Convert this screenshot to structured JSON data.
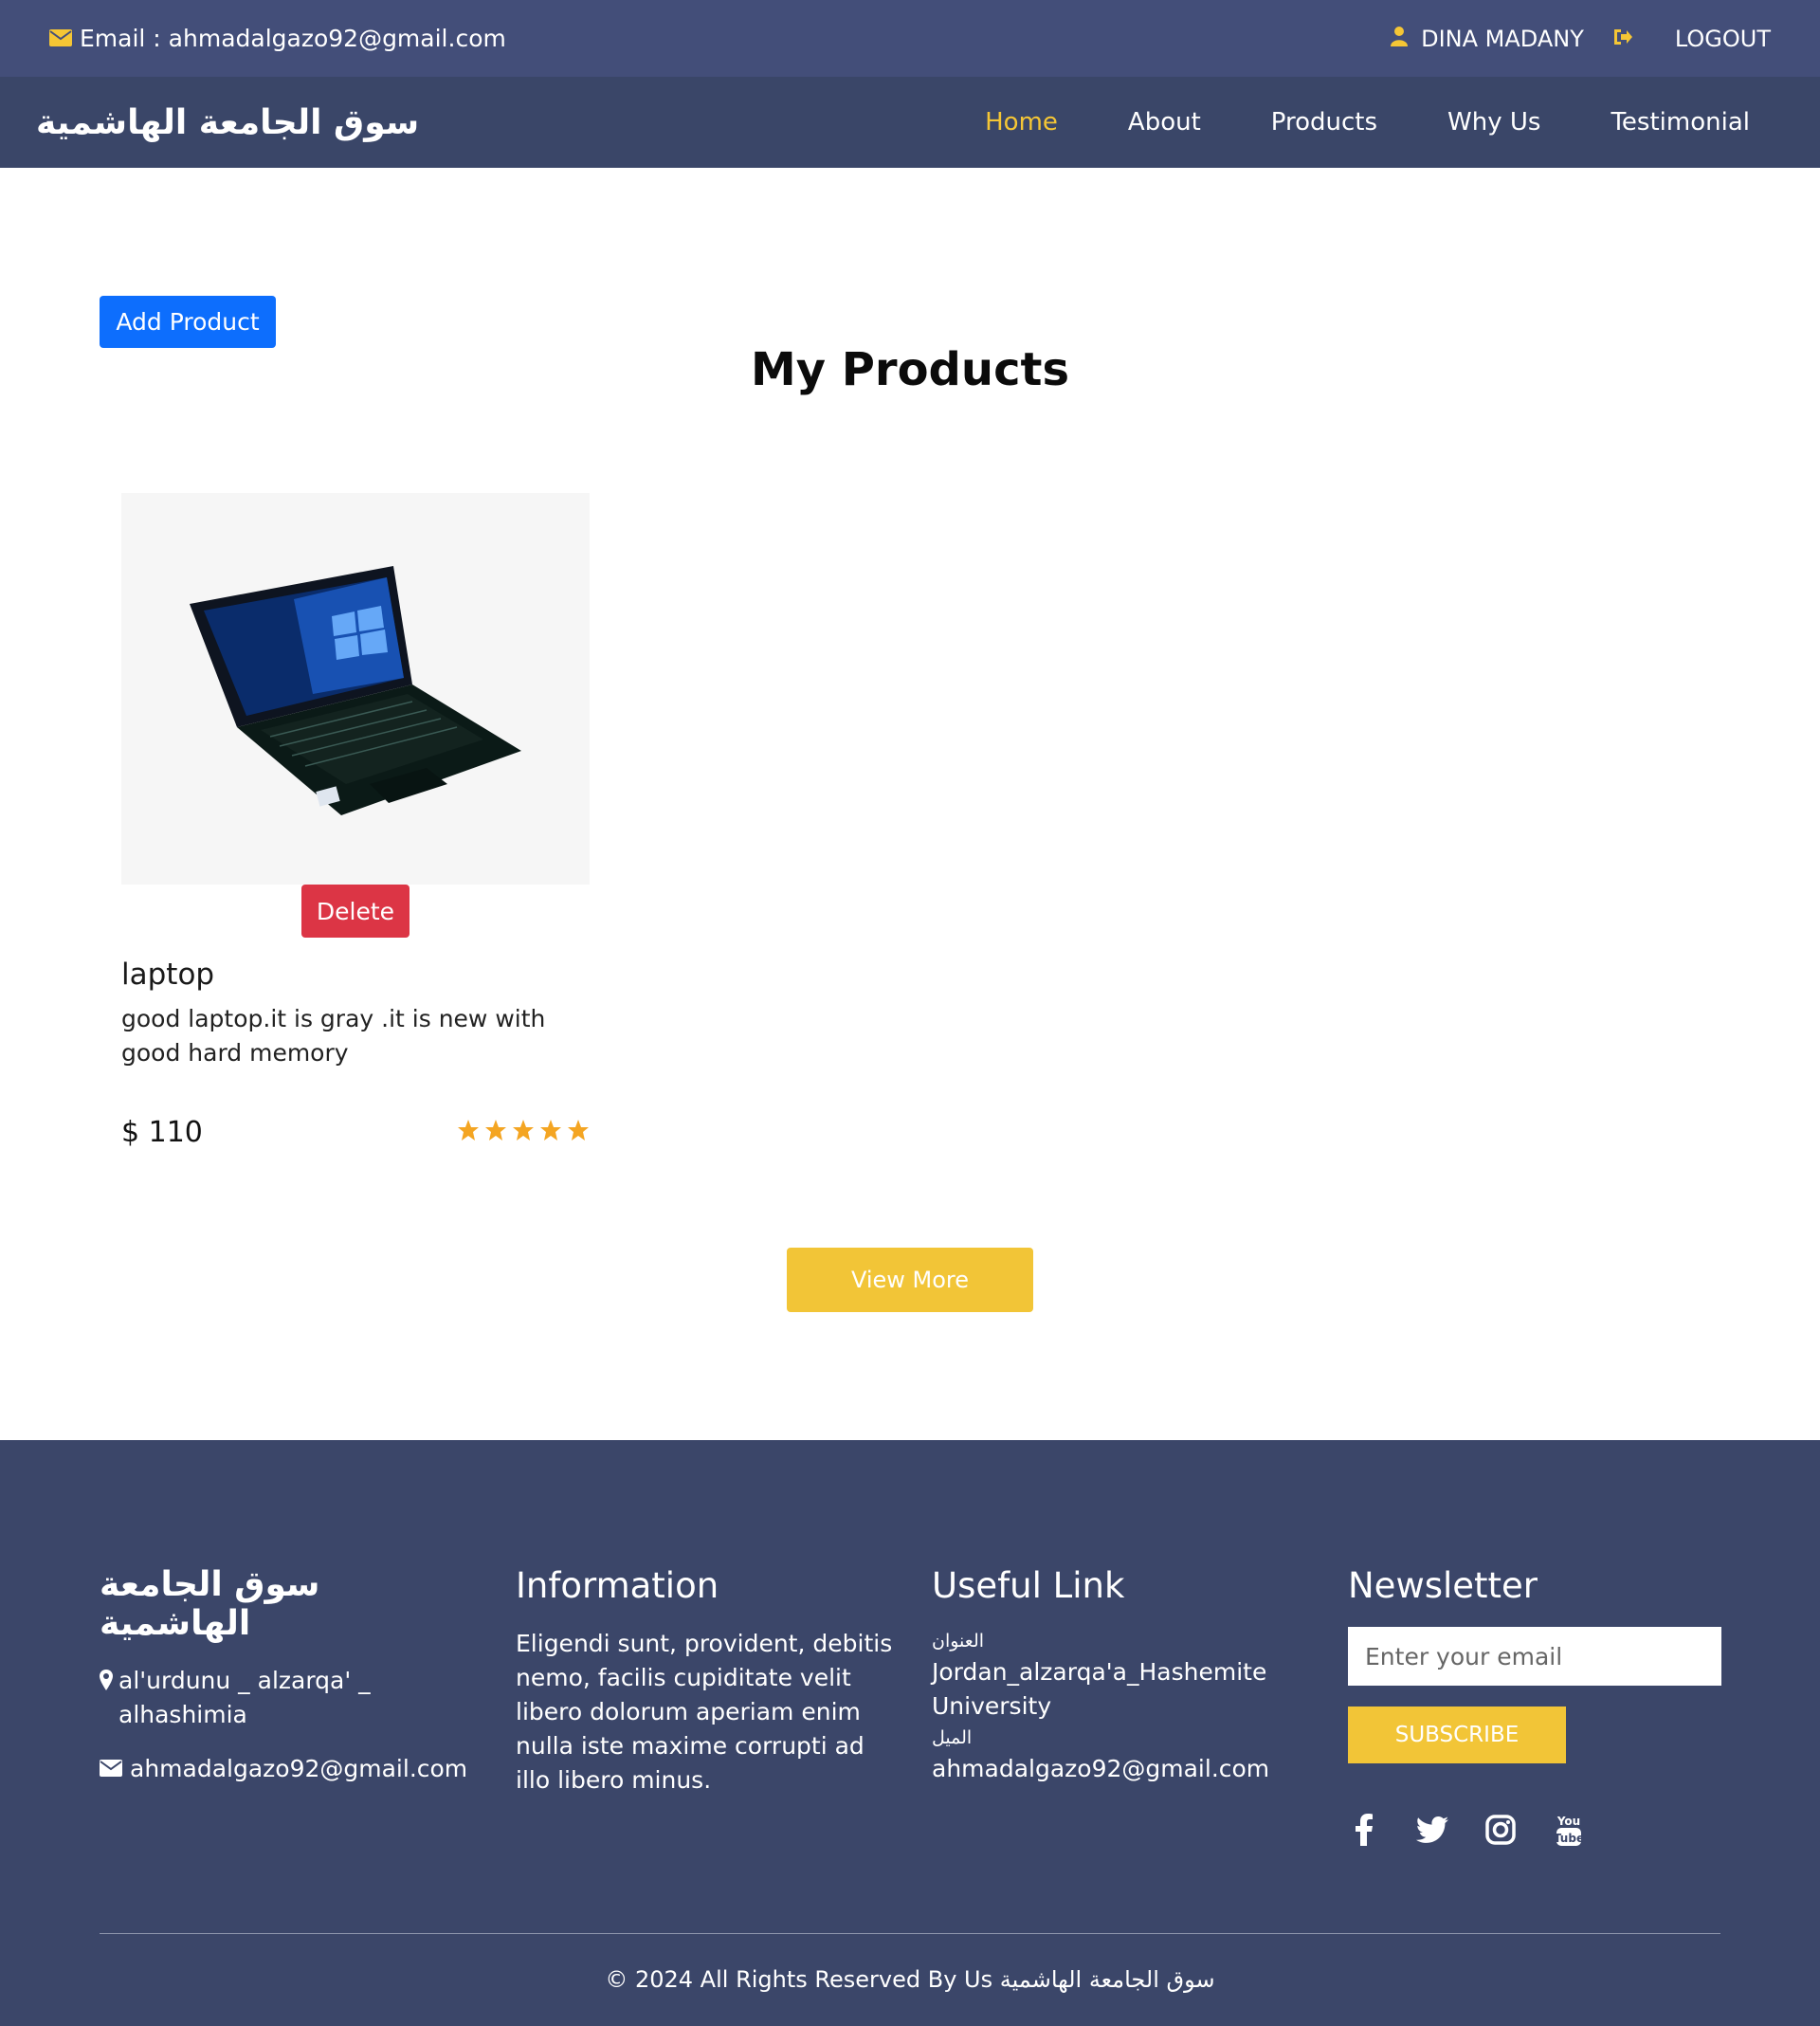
{
  "topbar": {
    "email_text": "Email : ahmadalgazo92@gmail.com",
    "user_name": "DINA MADANY",
    "logout_label": "LOGOUT"
  },
  "nav": {
    "brand": "سوق الجامعة الهاشمية",
    "links": [
      "Home",
      "About",
      "Products",
      "Why Us",
      "Testimonial"
    ],
    "active": "Home"
  },
  "main": {
    "add_button": "Add Product",
    "title": "My Products",
    "product": {
      "name": "laptop",
      "description": "good laptop.it is gray .it is new with good hard memory",
      "price": "$ 110",
      "rating": 5,
      "delete_label": "Delete"
    },
    "view_more": "View More"
  },
  "footer": {
    "brand": "سوق الجامعة الهاشمية",
    "address": "al'urdunu _ alzarqa' _ alhashimia",
    "email": "ahmadalgazo92@gmail.com",
    "info_title": "Information",
    "info_text": "Eligendi sunt, provident, debitis nemo, facilis cupiditate velit libero dolorum aperiam enim nulla iste maxime corrupti ad illo libero minus.",
    "useful_title": "Useful Link",
    "useful_address_label": "العنوان",
    "useful_address": "Jordan_alzarqa'a_Hashemite University",
    "useful_email_label": "الميل",
    "useful_email": "ahmadalgazo92@gmail.com",
    "newsletter_title": "Newsletter",
    "newsletter_placeholder": "Enter your email",
    "subscribe_label": "SUBSCRIBE",
    "socials": [
      "facebook-icon",
      "twitter-icon",
      "instagram-icon",
      "youtube-icon"
    ],
    "copyright": "© 2024 All Rights Reserved By Us سوق الجامعة الهاشمية"
  },
  "colors": {
    "topbar": "#434e79",
    "navbar": "#3a4668",
    "accent": "#f5c635",
    "primary": "#0d6efd",
    "danger": "#dc3545",
    "footer": "#3b4669"
  }
}
